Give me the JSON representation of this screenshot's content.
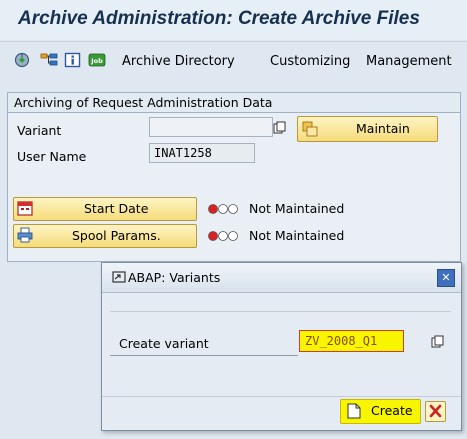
{
  "window": {
    "title": "Archive Administration: Create Archive Files"
  },
  "toolbar": {
    "icons": [
      "execute-icon",
      "org-structure-icon",
      "info-icon",
      "job-icon"
    ],
    "job_icon_text": "Job",
    "menu": [
      "Archive Directory",
      "Customizing",
      "Management"
    ]
  },
  "group": {
    "title": "Archiving of Request Administration Data",
    "variant_label": "Variant",
    "variant_value": "",
    "maintain_label": "Maintain",
    "user_label": "User Name",
    "user_value": "INAT1258",
    "start_date_label": "Start Date",
    "start_date_status": "Not Maintained",
    "spool_label": "Spool Params.",
    "spool_status": "Not Maintained"
  },
  "dialog": {
    "title": "ABAP: Variants",
    "field_label": "Create variant",
    "field_value": "ZV_2008_Q1",
    "create_label": "Create"
  },
  "colors": {
    "status_red": "#e02020",
    "highlight": "#f7f500",
    "button_yellow": "#f5dc79"
  }
}
